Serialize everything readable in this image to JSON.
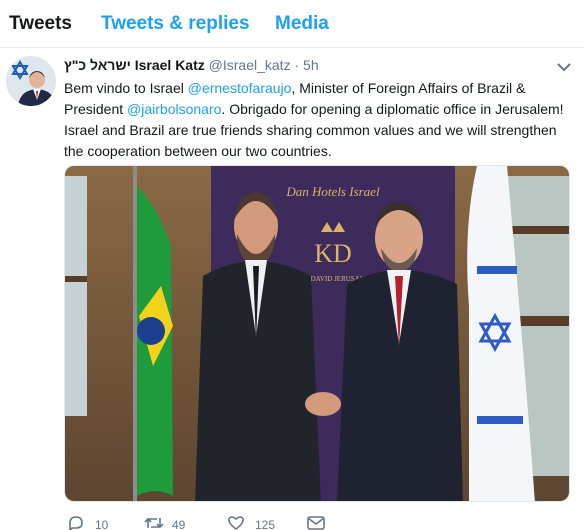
{
  "tabs": [
    {
      "label": "Tweets",
      "active": true
    },
    {
      "label": "Tweets & replies",
      "active": false
    },
    {
      "label": "Media",
      "active": false
    }
  ],
  "tweet": {
    "avatar_icon": "profile-photo-star-of-david",
    "display_name": "ישראל כ\"ץ Israel Katz",
    "handle": "@Israel_katz",
    "separator": "·",
    "time": "5h",
    "text_parts": [
      {
        "text": "Bem vindo to Israel ",
        "link": false
      },
      {
        "text": "@ernestofaraujo",
        "link": true
      },
      {
        "text": ", Minister of Foreign Affairs of Brazil & President ",
        "link": false
      },
      {
        "text": "@jairbolsonaro",
        "link": true
      },
      {
        "text": ". Obrigado for opening a diplomatic office in Jerusalem! Israel and Brazil are true friends sharing common values and we will strengthen the cooperation between our two countries.",
        "link": false
      }
    ],
    "photo": {
      "backdrop_text": "Dan Hotels Israel",
      "logo_text": "KD",
      "logo_subtext": "KING DAVID JERUSALEM"
    },
    "actions": {
      "reply_count": "10",
      "retweet_count": "49",
      "like_count": "125"
    }
  },
  "colors": {
    "accent": "#1da1f2",
    "text": "#14171a",
    "muted": "#657786",
    "border": "#e6ecf0"
  }
}
